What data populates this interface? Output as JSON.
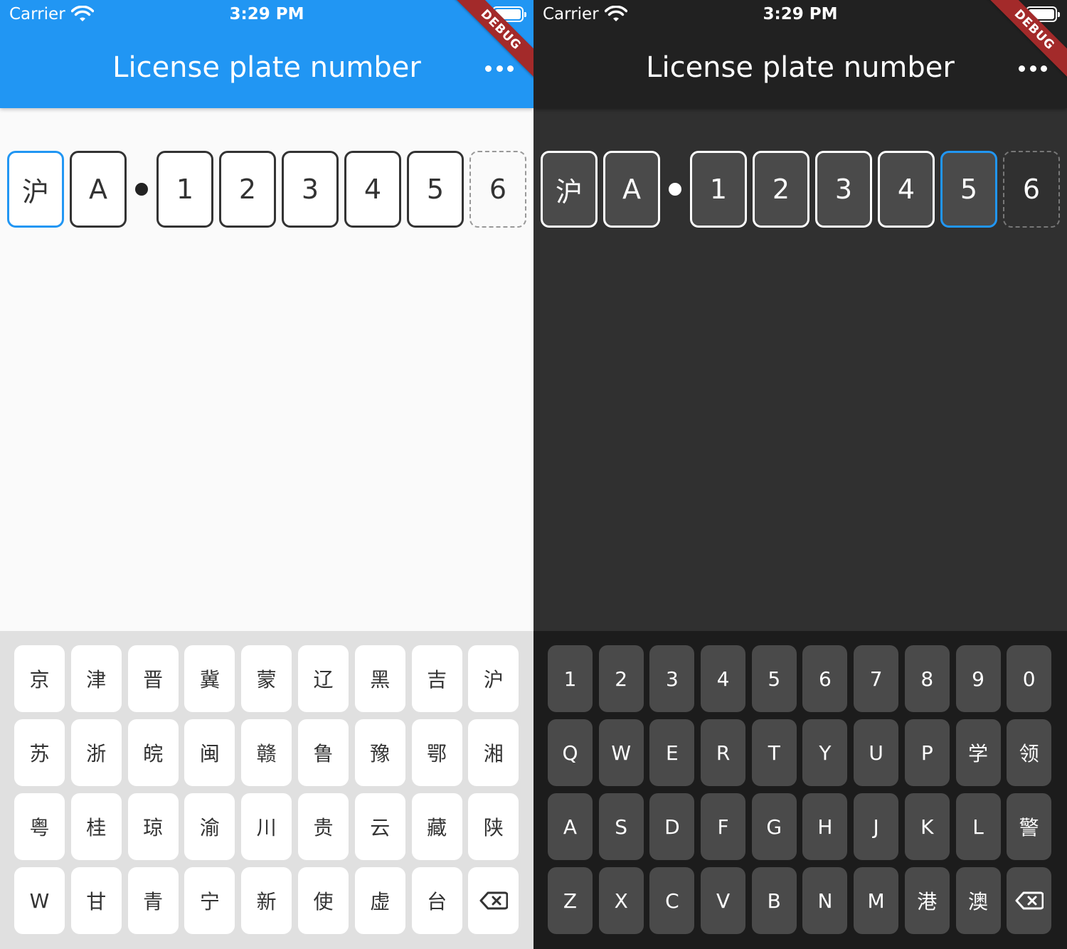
{
  "status": {
    "carrier": "Carrier",
    "time": "3:29 PM"
  },
  "appbar": {
    "title": "License plate number",
    "debug_banner": "DEBUG"
  },
  "light": {
    "plate": [
      "沪",
      "A",
      "1",
      "2",
      "3",
      "4",
      "5",
      "6"
    ],
    "active_index": 0,
    "keyboard": [
      [
        "京",
        "津",
        "晋",
        "冀",
        "蒙",
        "辽",
        "黑",
        "吉",
        "沪"
      ],
      [
        "苏",
        "浙",
        "皖",
        "闽",
        "赣",
        "鲁",
        "豫",
        "鄂",
        "湘"
      ],
      [
        "粤",
        "桂",
        "琼",
        "渝",
        "川",
        "贵",
        "云",
        "藏",
        "陕"
      ],
      [
        "W",
        "甘",
        "青",
        "宁",
        "新",
        "使",
        "虚",
        "台"
      ]
    ]
  },
  "dark": {
    "plate": [
      "沪",
      "A",
      "1",
      "2",
      "3",
      "4",
      "5",
      "6"
    ],
    "active_index": 6,
    "keyboard": [
      [
        "1",
        "2",
        "3",
        "4",
        "5",
        "6",
        "7",
        "8",
        "9",
        "0"
      ],
      [
        "Q",
        "W",
        "E",
        "R",
        "T",
        "Y",
        "U",
        "P",
        "学",
        "领"
      ],
      [
        "A",
        "S",
        "D",
        "F",
        "G",
        "H",
        "J",
        "K",
        "L",
        "警"
      ],
      [
        "Z",
        "X",
        "C",
        "V",
        "B",
        "N",
        "M",
        "港",
        "澳"
      ]
    ]
  },
  "icons": {
    "wifi": "wifi-icon",
    "battery": "battery-icon",
    "more": "more-horiz-icon",
    "backspace": "backspace-icon"
  },
  "colors": {
    "light_appbar": "#2196f3",
    "dark_appbar": "#212121",
    "active_border": "#2196f3"
  }
}
